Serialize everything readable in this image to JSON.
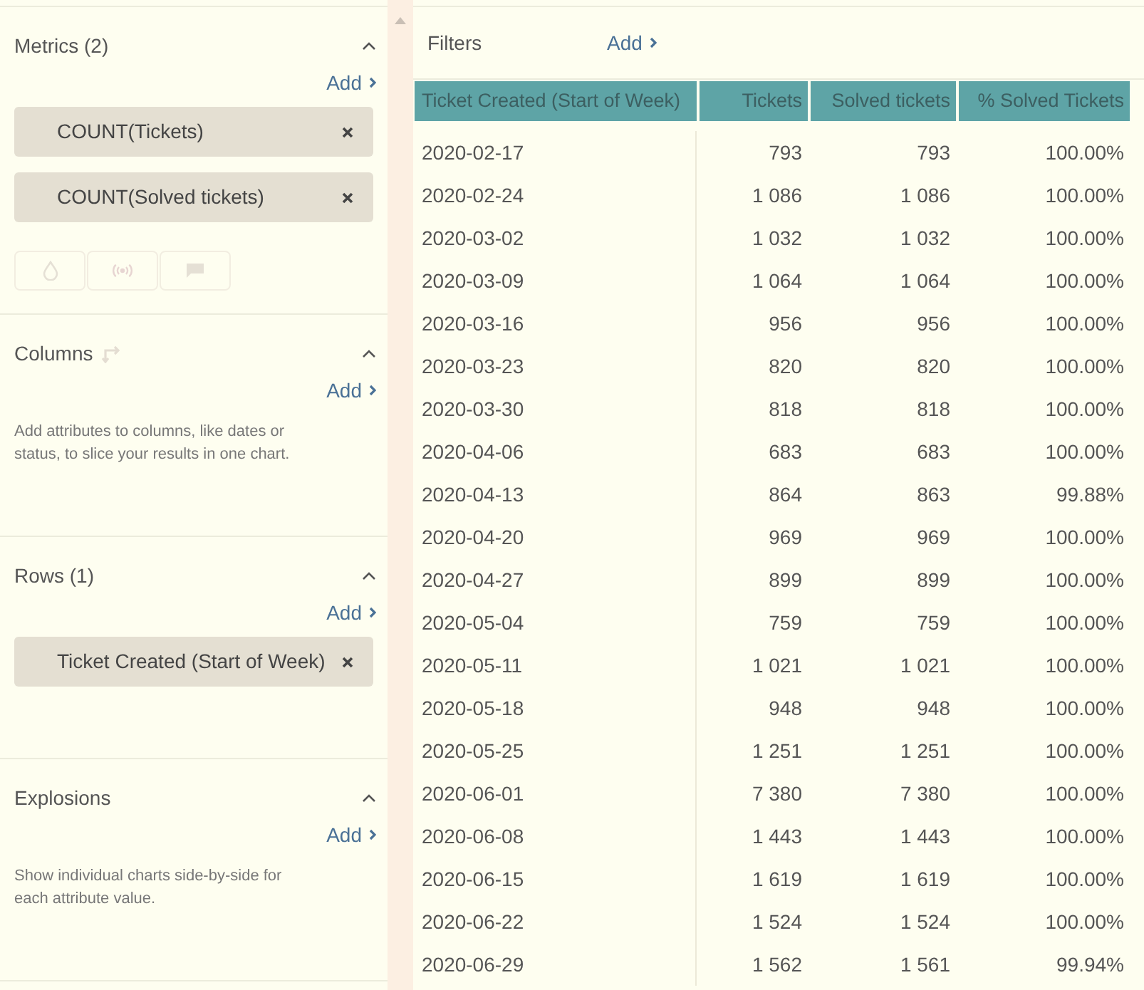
{
  "sections": [
    {
      "kind": "metrics",
      "title": "Metrics (2)",
      "add": "Add",
      "chips": [
        "COUNT(Tickets)",
        "COUNT(Solved tickets)"
      ],
      "tool_buttons": [
        {
          "kind": "drop",
          "disabled": true
        },
        {
          "kind": "signal",
          "disabled": true
        },
        {
          "kind": "comment",
          "disabled": true
        }
      ]
    },
    {
      "kind": "columns",
      "title": "Columns",
      "add": "Add",
      "description": "Add attributes to columns, like dates or status, to slice your results in one chart."
    },
    {
      "kind": "rows",
      "title": "Rows (1)",
      "add": "Add",
      "chips": [
        "Ticket Created (Start of Week)"
      ]
    },
    {
      "kind": "explosions",
      "title": "Explosions",
      "add": "Add",
      "description": "Show individual charts side-by-side for each attribute value."
    }
  ],
  "filters": {
    "label": "Filters",
    "add": "Add"
  },
  "table": {
    "columns": [
      "Ticket Created (Start of Week)",
      "Tickets",
      "Solved tickets",
      "% Solved Tickets"
    ],
    "rows": [
      [
        "2020-02-17",
        "793",
        "793",
        "100.00%"
      ],
      [
        "2020-02-24",
        "1 086",
        "1 086",
        "100.00%"
      ],
      [
        "2020-03-02",
        "1 032",
        "1 032",
        "100.00%"
      ],
      [
        "2020-03-09",
        "1 064",
        "1 064",
        "100.00%"
      ],
      [
        "2020-03-16",
        "956",
        "956",
        "100.00%"
      ],
      [
        "2020-03-23",
        "820",
        "820",
        "100.00%"
      ],
      [
        "2020-03-30",
        "818",
        "818",
        "100.00%"
      ],
      [
        "2020-04-06",
        "683",
        "683",
        "100.00%"
      ],
      [
        "2020-04-13",
        "864",
        "863",
        "99.88%"
      ],
      [
        "2020-04-20",
        "969",
        "969",
        "100.00%"
      ],
      [
        "2020-04-27",
        "899",
        "899",
        "100.00%"
      ],
      [
        "2020-05-04",
        "759",
        "759",
        "100.00%"
      ],
      [
        "2020-05-11",
        "1 021",
        "1 021",
        "100.00%"
      ],
      [
        "2020-05-18",
        "948",
        "948",
        "100.00%"
      ],
      [
        "2020-05-25",
        "1 251",
        "1 251",
        "100.00%"
      ],
      [
        "2020-06-01",
        "7 380",
        "7 380",
        "100.00%"
      ],
      [
        "2020-06-08",
        "1 443",
        "1 443",
        "100.00%"
      ],
      [
        "2020-06-15",
        "1 619",
        "1 619",
        "100.00%"
      ],
      [
        "2020-06-22",
        "1 524",
        "1 524",
        "100.00%"
      ],
      [
        "2020-06-29",
        "1 562",
        "1 561",
        "99.94%"
      ]
    ]
  }
}
